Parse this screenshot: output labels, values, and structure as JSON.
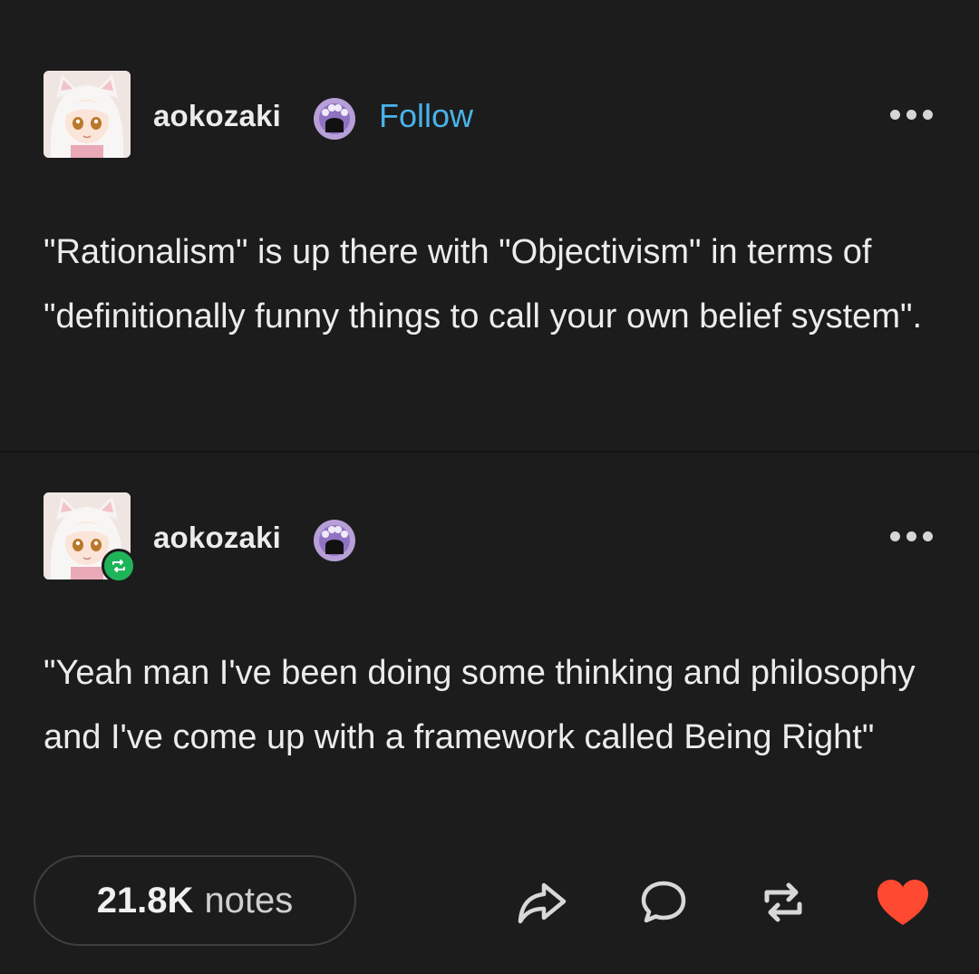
{
  "post": {
    "username": "aokozaki",
    "follow_label": "Follow",
    "text": "\"Rationalism\" is up there with \"Objectivism\" in terms of \"definitionally funny things to call your own belief system\"."
  },
  "reblog": {
    "username": "aokozaki",
    "text": "\"Yeah man I've been doing some thinking and philosophy and I've come up with a framework called Being Right\""
  },
  "footer": {
    "notes_count": "21.8K",
    "notes_label": "notes",
    "icons": [
      "share-icon",
      "comment-icon",
      "reblog-icon",
      "heart-icon"
    ],
    "like_color": "#ff4930"
  },
  "colors": {
    "background": "#1c1c1c",
    "follow": "#4ab2e8",
    "reblog_badge": "#1fb45a"
  }
}
